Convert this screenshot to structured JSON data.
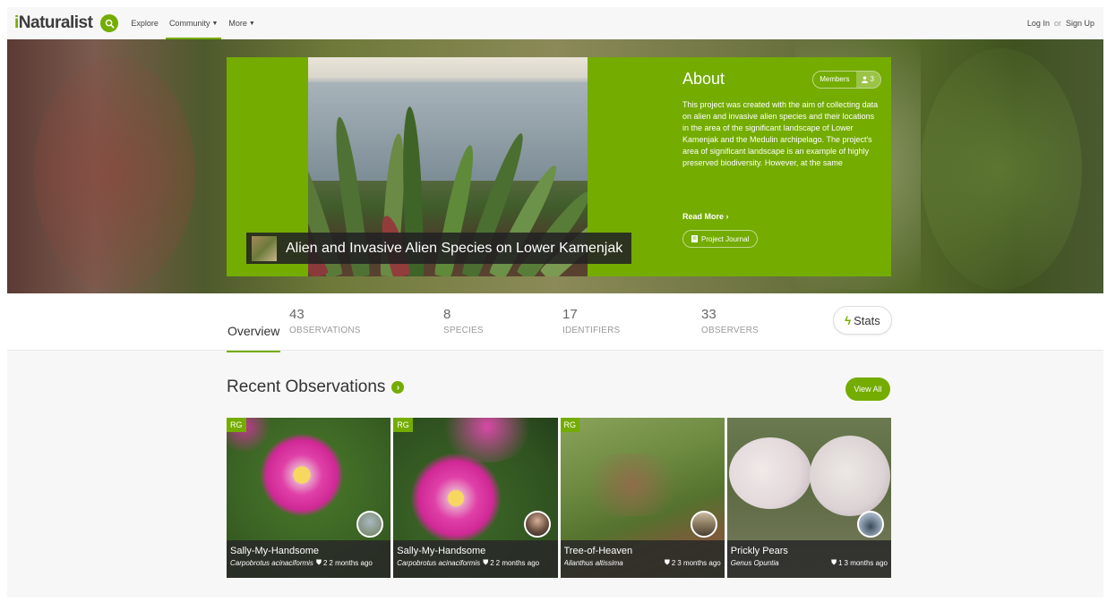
{
  "nav": {
    "logo_i": "i",
    "logo_rest": "Naturalist",
    "explore": "Explore",
    "community": "Community",
    "more": "More",
    "login": "Log In",
    "or": "or",
    "signup": "Sign Up"
  },
  "project": {
    "title": "Alien and Invasive Alien Species on Lower Kamenjak",
    "about_title": "About",
    "members_label": "Members",
    "members_count": "3",
    "description": "This project was created with the aim of collecting data on alien and invasive alien species and their locations in the area of the significant landscape of Lower Kamenjak and the Medulin archipelago. The project's area of significant landscape is an example of highly preserved biodiversity. However, at the same",
    "read_more": "Read More",
    "journal": "Project Journal"
  },
  "stats": {
    "overview": "Overview",
    "observations": {
      "num": "43",
      "label": "OBSERVATIONS"
    },
    "species": {
      "num": "8",
      "label": "SPECIES"
    },
    "identifiers": {
      "num": "17",
      "label": "IDENTIFIERS"
    },
    "observers": {
      "num": "33",
      "label": "OBSERVERS"
    },
    "stats_button": "Stats"
  },
  "recent": {
    "title": "Recent Observations",
    "view_all": "View All",
    "items": [
      {
        "rg": "RG",
        "name": "Sally-My-Handsome",
        "sci": "Carpobrotus acinaciformis",
        "ids": "2",
        "time": "2 months ago"
      },
      {
        "rg": "RG",
        "name": "Sally-My-Handsome",
        "sci": "Carpobrotus acinaciformis",
        "ids": "2",
        "time": "2 months ago"
      },
      {
        "rg": "RG",
        "name": "Tree-of-Heaven",
        "sci": "Ailanthus altissima",
        "ids": "2",
        "time": "3 months ago"
      },
      {
        "rg": "",
        "name": "Prickly Pears",
        "sci": "Genus Opuntia",
        "ids": "1",
        "time": "3 months ago"
      }
    ]
  },
  "colors": {
    "brand_green": "#74ac00",
    "dark_overlay": "#222222"
  }
}
